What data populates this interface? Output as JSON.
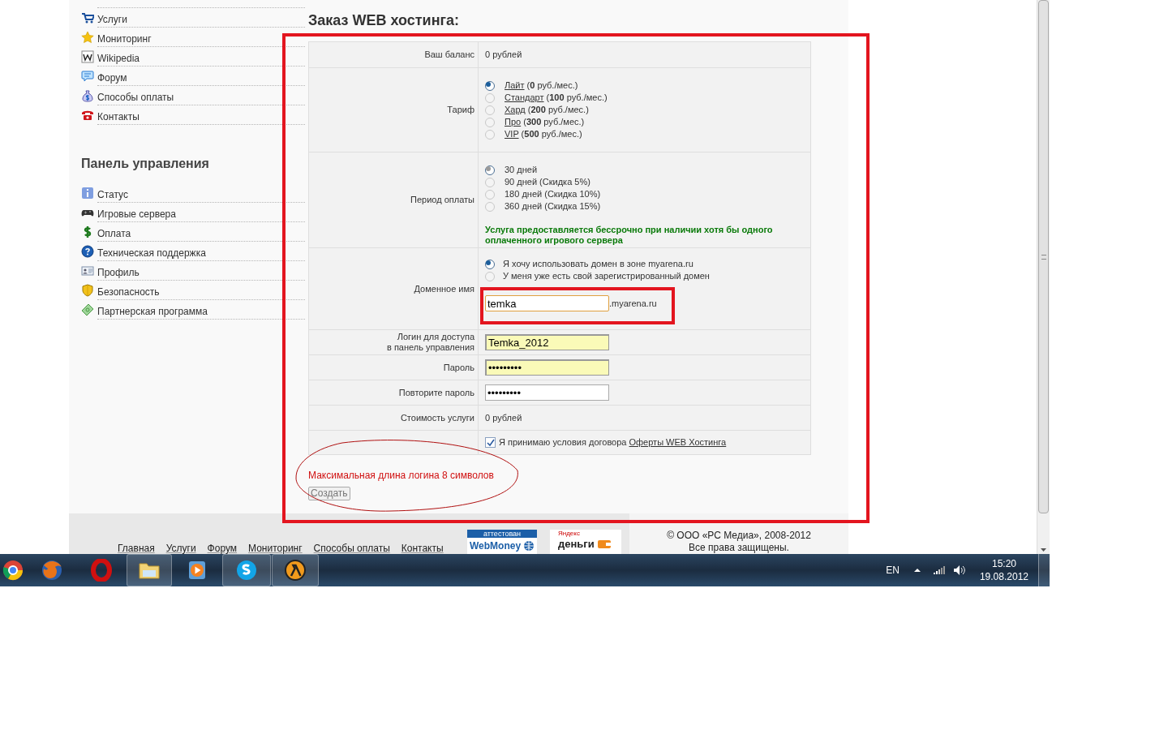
{
  "sidebar": {
    "menu": [
      "Услуги",
      "Мониторинг",
      "Wikipedia",
      "Форум",
      "Способы оплаты",
      "Контакты"
    ],
    "panel_title": "Панель управления",
    "panel_menu": [
      "Статус",
      "Игровые сервера",
      "Оплата",
      "Техническая поддержка",
      "Профиль",
      "Безопасность",
      "Партнерская программа"
    ]
  },
  "page_title": "Заказ WEB хостинга:",
  "form": {
    "rows": [
      {
        "kind": "text",
        "label": "Ваш баланс",
        "value": "0 рублей"
      },
      {
        "kind": "tariffs",
        "label": "Тариф",
        "options": [
          {
            "name": "Лайт",
            "price": "(**0** руб./мес.)",
            "selected": true
          },
          {
            "name": "Стандарт",
            "price": "(**100** руб./мес.)",
            "selected": false
          },
          {
            "name": "Хард",
            "price": "(**200** руб./мес.)",
            "selected": false
          },
          {
            "name": "Про",
            "price": "(**300** руб./мес.)",
            "selected": false
          },
          {
            "name": "VIP",
            "price": "(**500** руб./мес.)",
            "selected": false
          }
        ]
      },
      {
        "kind": "radios",
        "label": "Период оплаты",
        "options": [
          {
            "text": "30 дней",
            "selected": true
          },
          {
            "text": "90 дней (Скидка 5%)",
            "selected": false
          },
          {
            "text": "180 дней (Скидка 10%)",
            "selected": false
          },
          {
            "text": "360 дней (Скидка 15%)",
            "selected": false
          }
        ],
        "note": "Услуга предоставляется бессрочно при наличии хотя бы одного оплаченного игрового сервера"
      },
      {
        "kind": "domain",
        "label": "Доменное имя",
        "options": [
          {
            "text": "Я хочу использовать домен в зоне myarena.ru",
            "selected": true
          },
          {
            "text": "У меня уже есть свой зарегистрированный домен",
            "selected": false
          }
        ],
        "value": "temka",
        "suffix": ".myarena.ru"
      },
      {
        "kind": "input",
        "label": "Логин для доступа\nв панель управления",
        "value": "Temka_2012",
        "autofill": true
      },
      {
        "kind": "input",
        "label": "Пароль",
        "value": "•••••••••",
        "autofill": true
      },
      {
        "kind": "input",
        "label": "Повторите пароль",
        "value": "•••••••••",
        "autofill": false
      },
      {
        "kind": "text",
        "label": "Стоимость услуги",
        "value": "0 рублей"
      },
      {
        "kind": "agreement",
        "text": "Я принимаю условия договора",
        "link": "Оферты WEB Хостинга",
        "checked": true
      }
    ],
    "error": "Максимальная длина логина 8 символов",
    "submit": "Создать"
  },
  "footer": {
    "links": [
      "Главная",
      "Услуги",
      "Форум",
      "Мониторинг",
      "Способы оплаты",
      "Контакты"
    ],
    "webmoney_top": "аттестован",
    "webmoney": "WebMoney",
    "yandex_top": "Яндекс",
    "yandex": "деньги",
    "copyright": "© ООО «РС Медиа», 2008-2012",
    "rights": "Все права защищены."
  },
  "taskbar": {
    "apps": [
      {
        "running": false
      },
      {
        "running": false
      },
      {
        "running": false
      },
      {
        "running": true
      },
      {
        "running": false
      },
      {
        "running": true
      },
      {
        "running": true
      }
    ],
    "language": "EN",
    "time": "15:20",
    "date": "19.08.2012"
  }
}
